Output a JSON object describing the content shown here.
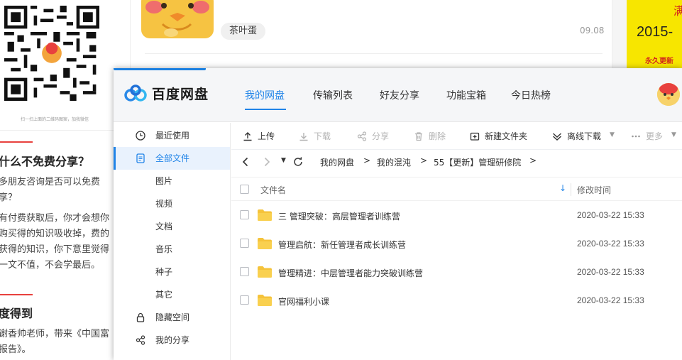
{
  "background_page": {
    "qr_caption": "扫一扫上面的二维码图案，加我微信",
    "heading1": "什么不免费分享？",
    "paragraph1": "多朋友咨询是否可以免费享？",
    "paragraph2": "有付费获取后，你才会想你购买得的知识吸收掉，费的获得的知识，你下意里觉得一文不值，不会学最后。",
    "heading2": "度得到",
    "paragraph3": "谢香帅老师，带来《中国富报告》。",
    "comment_tag": "茶叶蛋",
    "comment_date": "09.08",
    "ad_year": "2015-",
    "ad_slogan": "永久更新",
    "ad_top": "满"
  },
  "app": {
    "logo_text": "百度网盘",
    "nav": [
      {
        "label": "我的网盘",
        "active": true
      },
      {
        "label": "传输列表",
        "active": false
      },
      {
        "label": "好友分享",
        "active": false
      },
      {
        "label": "功能宝箱",
        "active": false
      },
      {
        "label": "今日热榜",
        "active": false
      }
    ],
    "sidebar": [
      {
        "label": "最近使用",
        "icon": "clock-icon",
        "active": false
      },
      {
        "label": "全部文件",
        "icon": "file-icon",
        "active": true
      },
      {
        "label": "图片",
        "icon": "",
        "active": false
      },
      {
        "label": "视频",
        "icon": "",
        "active": false
      },
      {
        "label": "文档",
        "icon": "",
        "active": false
      },
      {
        "label": "音乐",
        "icon": "",
        "active": false
      },
      {
        "label": "种子",
        "icon": "",
        "active": false
      },
      {
        "label": "其它",
        "icon": "",
        "active": false
      },
      {
        "label": "隐藏空间",
        "icon": "lock-icon",
        "active": false
      },
      {
        "label": "我的分享",
        "icon": "share-icon",
        "active": false
      }
    ],
    "toolbar": {
      "upload": "上传",
      "download": "下载",
      "share": "分享",
      "delete": "删除",
      "new_folder": "新建文件夹",
      "offline_download": "离线下载",
      "more": "更多"
    },
    "path": {
      "crumbs": [
        "我的网盘",
        "我的混沌",
        "55【更新】管理研修院"
      ],
      "separator": ">"
    },
    "table": {
      "col_name": "文件名",
      "col_mtime": "修改时间",
      "sort_indicator": "↓",
      "rows": [
        {
          "name": "三 管理突破：高层管理者训练营",
          "mtime": "2020-03-22 15:33"
        },
        {
          "name": "管理启航：新任管理者成长训练营",
          "mtime": "2020-03-22 15:33"
        },
        {
          "name": "管理精进：中层管理者能力突破训练营",
          "mtime": "2020-03-22 15:33"
        },
        {
          "name": "官网福利小课",
          "mtime": "2020-03-22 15:33"
        }
      ]
    },
    "colors": {
      "accent": "#2084e8",
      "folder": "#f5c33b",
      "sidebar_active_bg": "#e9f2fd"
    }
  }
}
